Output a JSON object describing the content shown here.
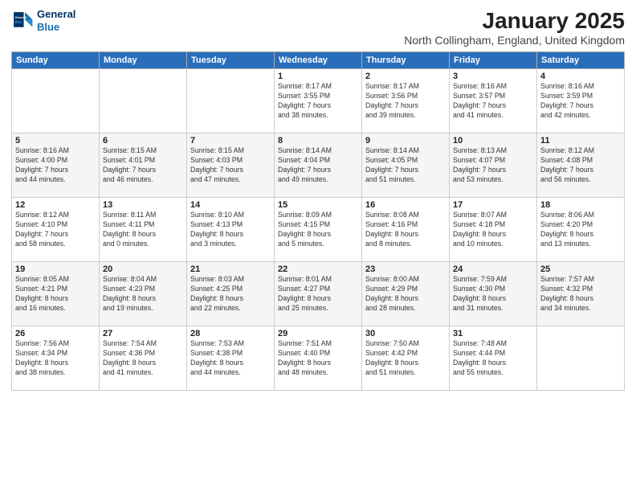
{
  "header": {
    "logo_line1": "General",
    "logo_line2": "Blue",
    "month_title": "January 2025",
    "location": "North Collingham, England, United Kingdom"
  },
  "days_of_week": [
    "Sunday",
    "Monday",
    "Tuesday",
    "Wednesday",
    "Thursday",
    "Friday",
    "Saturday"
  ],
  "weeks": [
    [
      {
        "day": "",
        "content": ""
      },
      {
        "day": "",
        "content": ""
      },
      {
        "day": "",
        "content": ""
      },
      {
        "day": "1",
        "content": "Sunrise: 8:17 AM\nSunset: 3:55 PM\nDaylight: 7 hours\nand 38 minutes."
      },
      {
        "day": "2",
        "content": "Sunrise: 8:17 AM\nSunset: 3:56 PM\nDaylight: 7 hours\nand 39 minutes."
      },
      {
        "day": "3",
        "content": "Sunrise: 8:16 AM\nSunset: 3:57 PM\nDaylight: 7 hours\nand 41 minutes."
      },
      {
        "day": "4",
        "content": "Sunrise: 8:16 AM\nSunset: 3:59 PM\nDaylight: 7 hours\nand 42 minutes."
      }
    ],
    [
      {
        "day": "5",
        "content": "Sunrise: 8:16 AM\nSunset: 4:00 PM\nDaylight: 7 hours\nand 44 minutes."
      },
      {
        "day": "6",
        "content": "Sunrise: 8:15 AM\nSunset: 4:01 PM\nDaylight: 7 hours\nand 46 minutes."
      },
      {
        "day": "7",
        "content": "Sunrise: 8:15 AM\nSunset: 4:03 PM\nDaylight: 7 hours\nand 47 minutes."
      },
      {
        "day": "8",
        "content": "Sunrise: 8:14 AM\nSunset: 4:04 PM\nDaylight: 7 hours\nand 49 minutes."
      },
      {
        "day": "9",
        "content": "Sunrise: 8:14 AM\nSunset: 4:05 PM\nDaylight: 7 hours\nand 51 minutes."
      },
      {
        "day": "10",
        "content": "Sunrise: 8:13 AM\nSunset: 4:07 PM\nDaylight: 7 hours\nand 53 minutes."
      },
      {
        "day": "11",
        "content": "Sunrise: 8:12 AM\nSunset: 4:08 PM\nDaylight: 7 hours\nand 56 minutes."
      }
    ],
    [
      {
        "day": "12",
        "content": "Sunrise: 8:12 AM\nSunset: 4:10 PM\nDaylight: 7 hours\nand 58 minutes."
      },
      {
        "day": "13",
        "content": "Sunrise: 8:11 AM\nSunset: 4:11 PM\nDaylight: 8 hours\nand 0 minutes."
      },
      {
        "day": "14",
        "content": "Sunrise: 8:10 AM\nSunset: 4:13 PM\nDaylight: 8 hours\nand 3 minutes."
      },
      {
        "day": "15",
        "content": "Sunrise: 8:09 AM\nSunset: 4:15 PM\nDaylight: 8 hours\nand 5 minutes."
      },
      {
        "day": "16",
        "content": "Sunrise: 8:08 AM\nSunset: 4:16 PM\nDaylight: 8 hours\nand 8 minutes."
      },
      {
        "day": "17",
        "content": "Sunrise: 8:07 AM\nSunset: 4:18 PM\nDaylight: 8 hours\nand 10 minutes."
      },
      {
        "day": "18",
        "content": "Sunrise: 8:06 AM\nSunset: 4:20 PM\nDaylight: 8 hours\nand 13 minutes."
      }
    ],
    [
      {
        "day": "19",
        "content": "Sunrise: 8:05 AM\nSunset: 4:21 PM\nDaylight: 8 hours\nand 16 minutes."
      },
      {
        "day": "20",
        "content": "Sunrise: 8:04 AM\nSunset: 4:23 PM\nDaylight: 8 hours\nand 19 minutes."
      },
      {
        "day": "21",
        "content": "Sunrise: 8:03 AM\nSunset: 4:25 PM\nDaylight: 8 hours\nand 22 minutes."
      },
      {
        "day": "22",
        "content": "Sunrise: 8:01 AM\nSunset: 4:27 PM\nDaylight: 8 hours\nand 25 minutes."
      },
      {
        "day": "23",
        "content": "Sunrise: 8:00 AM\nSunset: 4:29 PM\nDaylight: 8 hours\nand 28 minutes."
      },
      {
        "day": "24",
        "content": "Sunrise: 7:59 AM\nSunset: 4:30 PM\nDaylight: 8 hours\nand 31 minutes."
      },
      {
        "day": "25",
        "content": "Sunrise: 7:57 AM\nSunset: 4:32 PM\nDaylight: 8 hours\nand 34 minutes."
      }
    ],
    [
      {
        "day": "26",
        "content": "Sunrise: 7:56 AM\nSunset: 4:34 PM\nDaylight: 8 hours\nand 38 minutes."
      },
      {
        "day": "27",
        "content": "Sunrise: 7:54 AM\nSunset: 4:36 PM\nDaylight: 8 hours\nand 41 minutes."
      },
      {
        "day": "28",
        "content": "Sunrise: 7:53 AM\nSunset: 4:38 PM\nDaylight: 8 hours\nand 44 minutes."
      },
      {
        "day": "29",
        "content": "Sunrise: 7:51 AM\nSunset: 4:40 PM\nDaylight: 8 hours\nand 48 minutes."
      },
      {
        "day": "30",
        "content": "Sunrise: 7:50 AM\nSunset: 4:42 PM\nDaylight: 8 hours\nand 51 minutes."
      },
      {
        "day": "31",
        "content": "Sunrise: 7:48 AM\nSunset: 4:44 PM\nDaylight: 8 hours\nand 55 minutes."
      },
      {
        "day": "",
        "content": ""
      }
    ]
  ]
}
